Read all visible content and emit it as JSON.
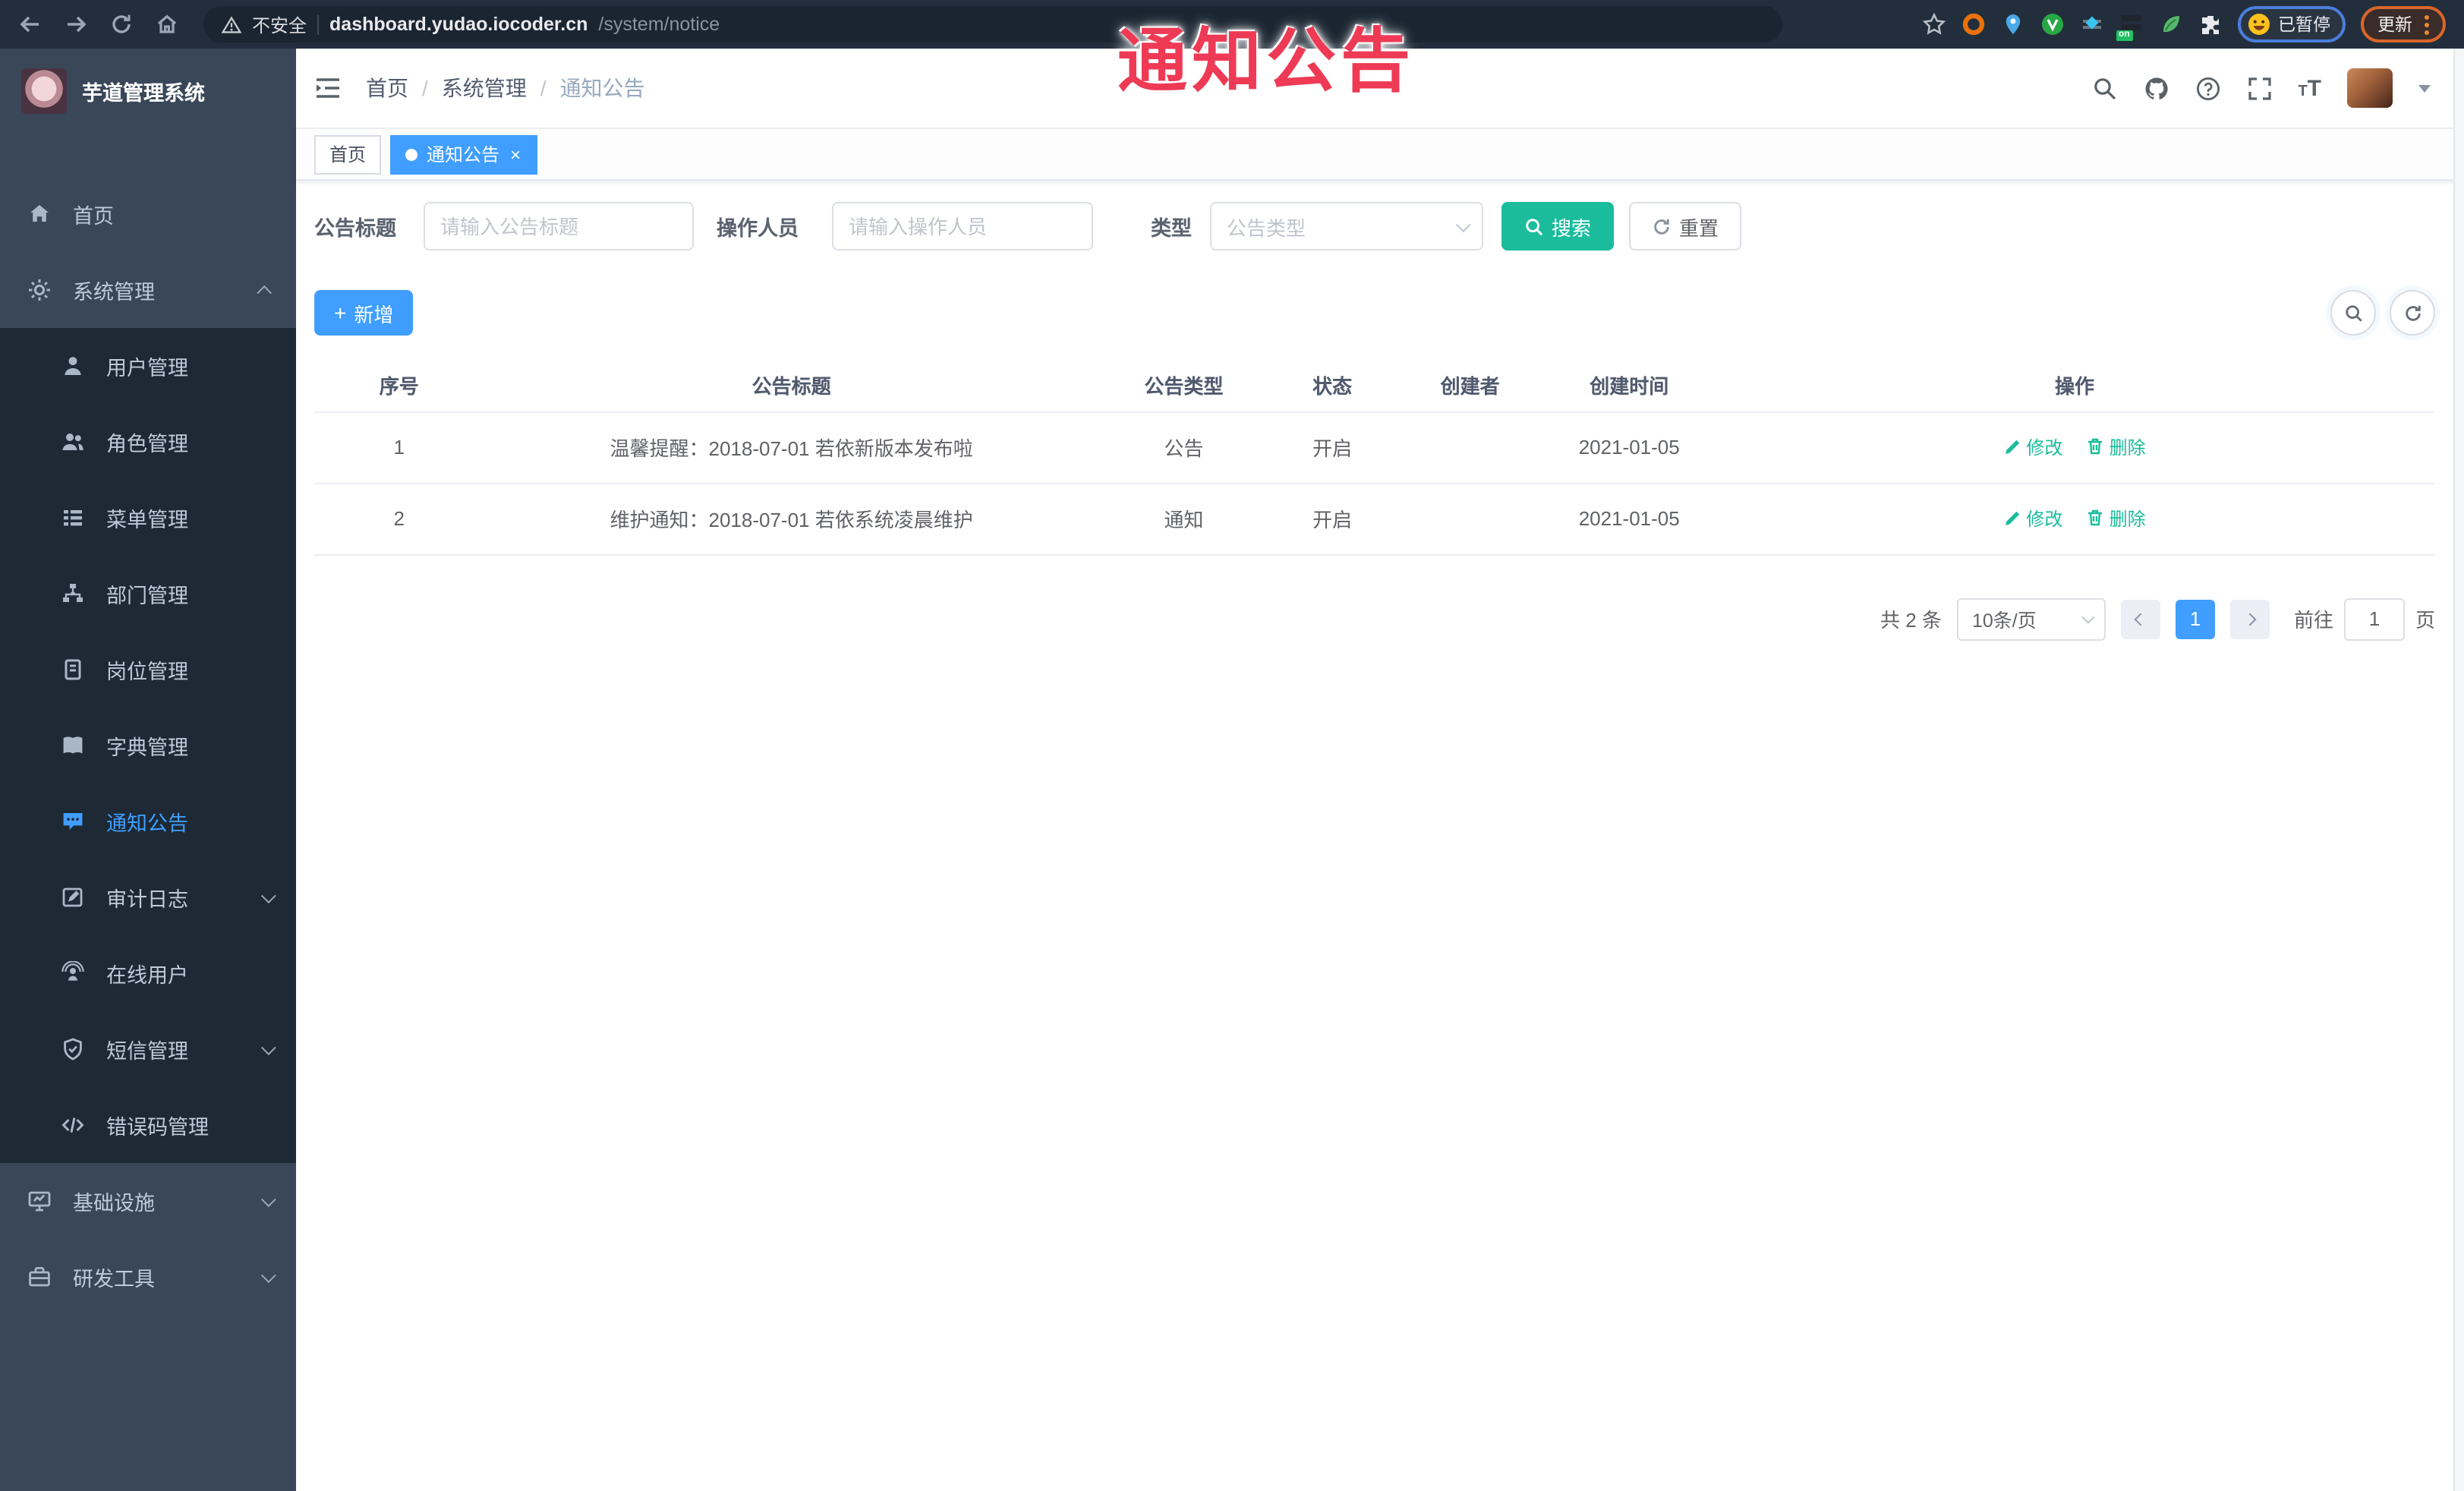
{
  "browser": {
    "security_warning": "不安全",
    "url_domain": "dashboard.yudao.iocoder.cn",
    "url_path": "/system/notice",
    "extension_badge": "on",
    "profile_status": "已暂停",
    "update_label": "更新"
  },
  "annotation": {
    "text": "通知公告"
  },
  "sidebar": {
    "title": "芋道管理系统",
    "menu": [
      {
        "label": "首页"
      },
      {
        "label": "系统管理",
        "children": [
          {
            "label": "用户管理"
          },
          {
            "label": "角色管理"
          },
          {
            "label": "菜单管理"
          },
          {
            "label": "部门管理"
          },
          {
            "label": "岗位管理"
          },
          {
            "label": "字典管理"
          },
          {
            "label": "通知公告"
          },
          {
            "label": "审计日志"
          },
          {
            "label": "在线用户"
          },
          {
            "label": "短信管理"
          },
          {
            "label": "错误码管理"
          }
        ]
      },
      {
        "label": "基础设施"
      },
      {
        "label": "研发工具"
      }
    ]
  },
  "header": {
    "breadcrumb": [
      "首页",
      "系统管理",
      "通知公告"
    ],
    "separator": "/"
  },
  "tabs": [
    {
      "label": "首页"
    },
    {
      "label": "通知公告",
      "close": "×"
    }
  ],
  "filters": {
    "title_label": "公告标题",
    "title_placeholder": "请输入公告标题",
    "operator_label": "操作人员",
    "operator_placeholder": "请输入操作人员",
    "type_label": "类型",
    "type_placeholder": "公告类型",
    "search_label": "搜索",
    "reset_label": "重置"
  },
  "toolbar": {
    "add_label": "新增",
    "plus": "+"
  },
  "table": {
    "headers": [
      "序号",
      "公告标题",
      "公告类型",
      "状态",
      "创建者",
      "创建时间",
      "操作"
    ],
    "rows": [
      {
        "seq": "1",
        "title": "温馨提醒：2018-07-01 若依新版本发布啦",
        "type": "公告",
        "status": "开启",
        "creator": "",
        "created": "2021-01-05"
      },
      {
        "seq": "2",
        "title": "维护通知：2018-07-01 若依系统凌晨维护",
        "type": "通知",
        "status": "开启",
        "creator": "",
        "created": "2021-01-05"
      }
    ],
    "edit_label": "修改",
    "delete_label": "删除"
  },
  "pagination": {
    "total": "共 2 条",
    "page_size": "10条/页",
    "page": "1",
    "goto_label": "前往",
    "goto_value": "1",
    "page_unit": "页"
  },
  "colors": {
    "primary": "#3f9eff",
    "search_button": "#1abc9c",
    "annotation": "#ee3a55",
    "sidebar_bg": "#394759",
    "submenu_bg": "#1d2935"
  }
}
